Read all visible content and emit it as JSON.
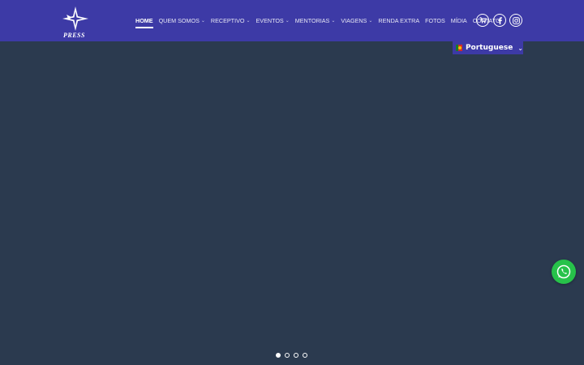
{
  "brand": {
    "logo_text": "PRESS"
  },
  "nav": {
    "items": [
      {
        "label": "HOME",
        "active": true,
        "has_dropdown": false
      },
      {
        "label": "QUEM SOMOS",
        "active": false,
        "has_dropdown": true
      },
      {
        "label": "RECEPTIVO",
        "active": false,
        "has_dropdown": true
      },
      {
        "label": "EVENTOS",
        "active": false,
        "has_dropdown": true
      },
      {
        "label": "MENTORIAS",
        "active": false,
        "has_dropdown": true
      },
      {
        "label": "VIAGENS",
        "active": false,
        "has_dropdown": true
      },
      {
        "label": "RENDA EXTRA",
        "active": false,
        "has_dropdown": false
      },
      {
        "label": "FOTOS",
        "active": false,
        "has_dropdown": false
      },
      {
        "label": "MÍDIA",
        "active": false,
        "has_dropdown": false
      },
      {
        "label": "CONTATO",
        "active": false,
        "has_dropdown": false
      }
    ],
    "icons": [
      "cart-icon",
      "facebook-icon",
      "instagram-icon"
    ]
  },
  "language": {
    "label": "Portuguese",
    "flag": "portugal-flag"
  },
  "slider": {
    "dot_count": 4,
    "active_index": 0
  },
  "colors": {
    "header": "#3d3aa6",
    "hero": "#2b3a4f",
    "whatsapp": "#27c24a"
  }
}
